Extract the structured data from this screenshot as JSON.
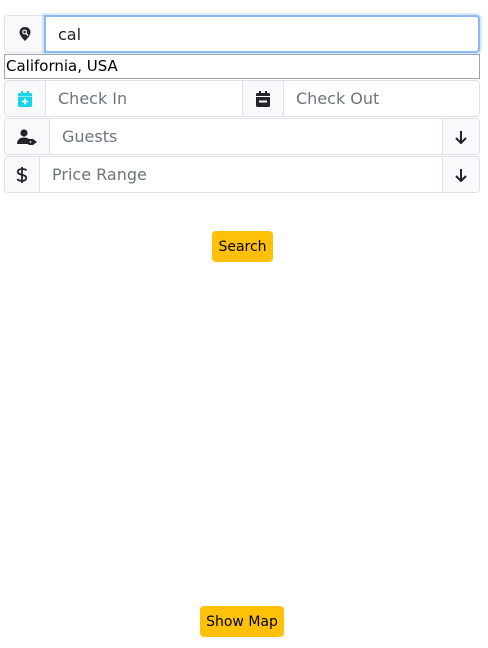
{
  "search": {
    "value": "cal",
    "icon": "map-pin-search-icon",
    "suggestion": "California, USA"
  },
  "dates": {
    "check_in_placeholder": "Check In",
    "check_out_placeholder": "Check Out",
    "check_in_icon": "calendar-plus-icon",
    "check_out_icon": "calendar-icon",
    "check_in_icon_color": "#19d3e8"
  },
  "guests": {
    "placeholder": "Guests",
    "icon": "user-tag-icon",
    "arrow_icon": "arrow-down-icon"
  },
  "price": {
    "placeholder": "Price Range",
    "icon": "dollar-icon",
    "arrow_icon": "arrow-down-icon"
  },
  "buttons": {
    "search_label": "Search",
    "show_map_label": "Show Map",
    "accent_color": "#ffc107"
  }
}
